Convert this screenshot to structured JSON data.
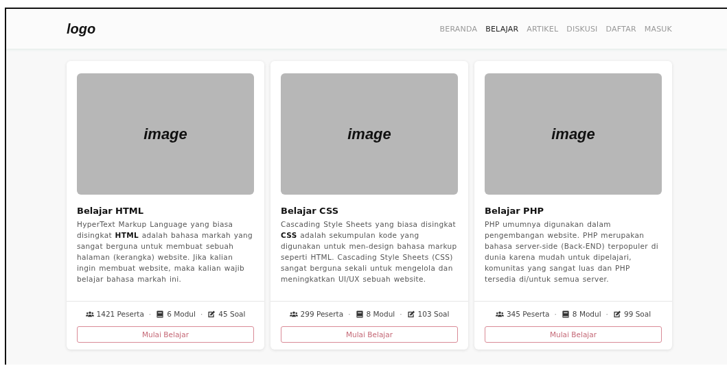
{
  "header": {
    "logo": "logo",
    "nav": [
      {
        "label": "BERANDA",
        "selected": false
      },
      {
        "label": "BELAJAR",
        "selected": true
      },
      {
        "label": "ARTIKEL",
        "selected": false
      },
      {
        "label": "DISKUSI",
        "selected": false
      },
      {
        "label": "DAFTAR",
        "selected": false
      },
      {
        "label": "MASUK",
        "selected": false
      }
    ]
  },
  "separator": "·",
  "courses": [
    {
      "image_label": "image",
      "title": "Belajar HTML",
      "description": "HyperText Markup Language yang biasa disingkat **HTML** adalah bahasa markah yang sangat berguna untuk membuat sebuah halaman (kerangka) website. Jika kalian ingin membuat website, maka kalian wajib belajar bahasa markah ini.",
      "stats": [
        {
          "kind": "participants",
          "text": "1421 Peserta"
        },
        {
          "kind": "modules",
          "text": "6 Modul"
        },
        {
          "kind": "questions",
          "text": "45 Soal"
        }
      ],
      "button": "Mulai Belajar"
    },
    {
      "image_label": "image",
      "title": "Belajar CSS",
      "description": "Cascading Style Sheets yang biasa disingkat **CSS** adalah sekumpulan kode yang digunakan untuk men-design bahasa markup seperti HTML. Cascading Style Sheets (CSS) sangat berguna sekali untuk mengelola dan meningkatkan UI/UX sebuah website.",
      "stats": [
        {
          "kind": "participants",
          "text": "299 Peserta"
        },
        {
          "kind": "modules",
          "text": "8 Modul"
        },
        {
          "kind": "questions",
          "text": "103 Soal"
        }
      ],
      "button": "Mulai Belajar"
    },
    {
      "image_label": "image",
      "title": "Belajar PHP",
      "description": "PHP umumnya digunakan dalam pengembangan website. PHP merupakan bahasa server-side (Back-END) terpopuler di dunia karena mudah untuk dipelajari, komunitas yang sangat luas dan PHP tersedia di/untuk semua server.",
      "stats": [
        {
          "kind": "participants",
          "text": "345 Peserta"
        },
        {
          "kind": "modules",
          "text": "8 Modul"
        },
        {
          "kind": "questions",
          "text": "99 Soal"
        }
      ],
      "button": "Mulai Belajar"
    }
  ]
}
